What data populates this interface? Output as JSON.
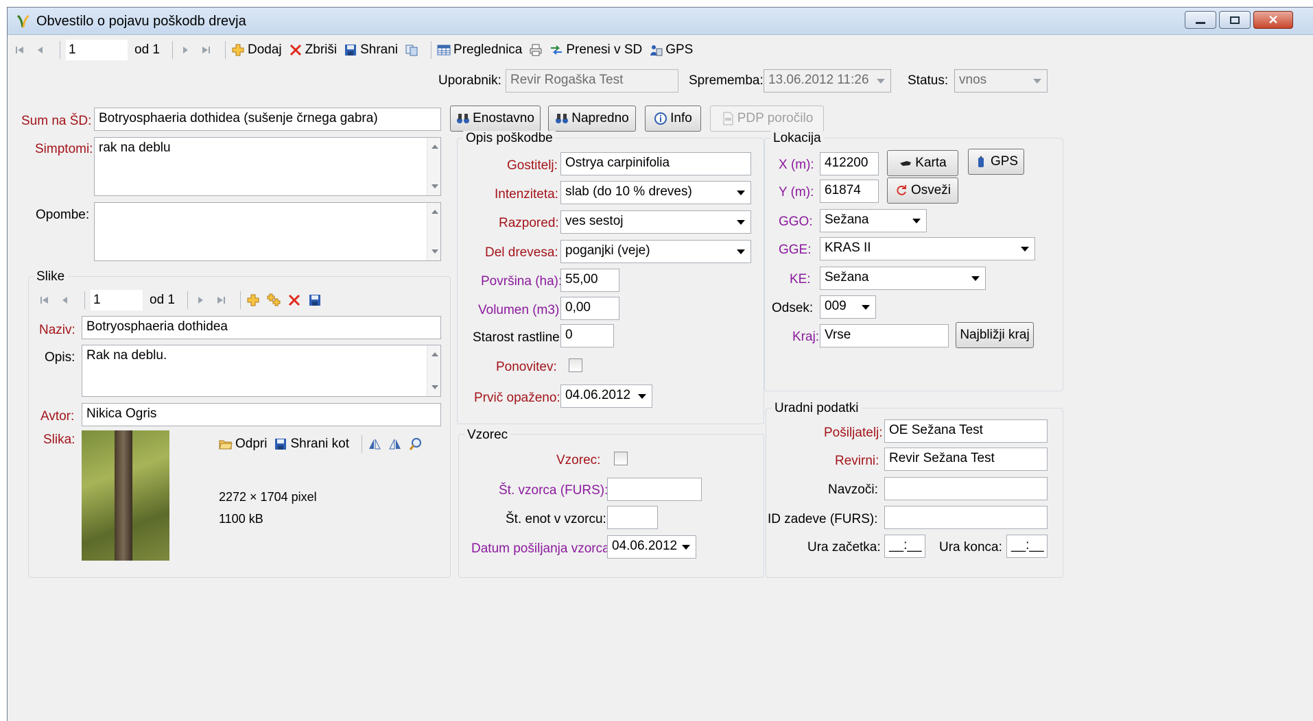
{
  "window": {
    "title": "Obvestilo o pojavu poškodb drevja"
  },
  "toolbar": {
    "record_value": "1",
    "record_of": "od 1",
    "add_label": "Dodaj",
    "delete_label": "Zbriši",
    "save_label": "Shrani",
    "grid_label": "Preglednica",
    "transfer_label": "Prenesi v SD",
    "gps_label": "GPS"
  },
  "header": {
    "user_label": "Uporabnik:",
    "user_value": "Revir Rogaška Test",
    "change_label": "Sprememba:",
    "change_value": "13.06.2012 11:26",
    "status_label": "Status:",
    "status_value": "vnos"
  },
  "main": {
    "sum_label": "Sum na ŠD:",
    "sum_value": "Botryosphaeria dothidea (sušenje črnega gabra)",
    "symptoms_label": "Simptomi:",
    "symptoms_value": "rak na deblu",
    "notes_label": "Opombe:",
    "notes_value": "",
    "btn_simple": "Enostavno",
    "btn_advanced": "Napredno",
    "btn_info": "Info",
    "btn_pdf": "PDP poročilo"
  },
  "images": {
    "group_title": "Slike",
    "record_value": "1",
    "record_of": "od 1",
    "name_label": "Naziv:",
    "name_value": "Botryosphaeria dothidea",
    "desc_label": "Opis:",
    "desc_value": "Rak na deblu.",
    "author_label": "Avtor:",
    "author_value": "Nikica Ogris",
    "image_label": "Slika:",
    "open_label": "Odpri",
    "saveas_label": "Shrani kot",
    "dimensions": "2272 × 1704 pixel",
    "size": "1100 kB"
  },
  "damage": {
    "group_title": "Opis poškodbe",
    "host_label": "Gostitelj:",
    "host_value": "Ostrya carpinifolia",
    "intensity_label": "Intenziteta:",
    "intensity_value": "slab (do 10 % dreves)",
    "distribution_label": "Razpored:",
    "distribution_value": "ves sestoj",
    "part_label": "Del drevesa:",
    "part_value": "poganjki (veje)",
    "area_label": "Površina (ha):",
    "area_value": "55,00",
    "volume_label": "Volumen (m3):",
    "volume_value": "0,00",
    "age_label": "Starost rastline:",
    "age_value": "0",
    "repeat_label": "Ponovitev:",
    "first_seen_label": "Prvič opaženo:",
    "first_seen_value": "04.06.2012"
  },
  "sample": {
    "group_title": "Vzorec",
    "sample_label": "Vzorec:",
    "sample_no_label": "Št. vzorca (FURS):",
    "sample_no_value": "",
    "units_label": "Št. enot v vzorcu:",
    "units_value": "",
    "send_date_label": "Datum pošiljanja vzorca:",
    "send_date_value": "04.06.2012"
  },
  "location": {
    "group_title": "Lokacija",
    "x_label": "X (m):",
    "x_value": "412200",
    "y_label": "Y (m):",
    "y_value": "61874",
    "map_button": "Karta",
    "gps_button": "GPS",
    "refresh_button": "Osveži",
    "ggo_label": "GGO:",
    "ggo_value": "Sežana",
    "gge_label": "GGE:",
    "gge_value": "KRAS II",
    "ke_label": "KE:",
    "ke_value": "Sežana",
    "section_label": "Odsek:",
    "section_value": "009",
    "place_label": "Kraj:",
    "place_value": "Vrse",
    "nearest_button": "Najbližji kraj"
  },
  "official": {
    "group_title": "Uradni podatki",
    "sender_label": "Pošiljatelj:",
    "sender_value": "OE Sežana Test",
    "district_label": "Revirni:",
    "district_value": "Revir Sežana Test",
    "present_label": "Navzoči:",
    "present_value": "",
    "case_label": "ID zadeve (FURS):",
    "case_value": "",
    "start_label": "Ura začetka:",
    "start_value": "__:__",
    "end_label": "Ura konca:",
    "end_value": "__:__"
  }
}
